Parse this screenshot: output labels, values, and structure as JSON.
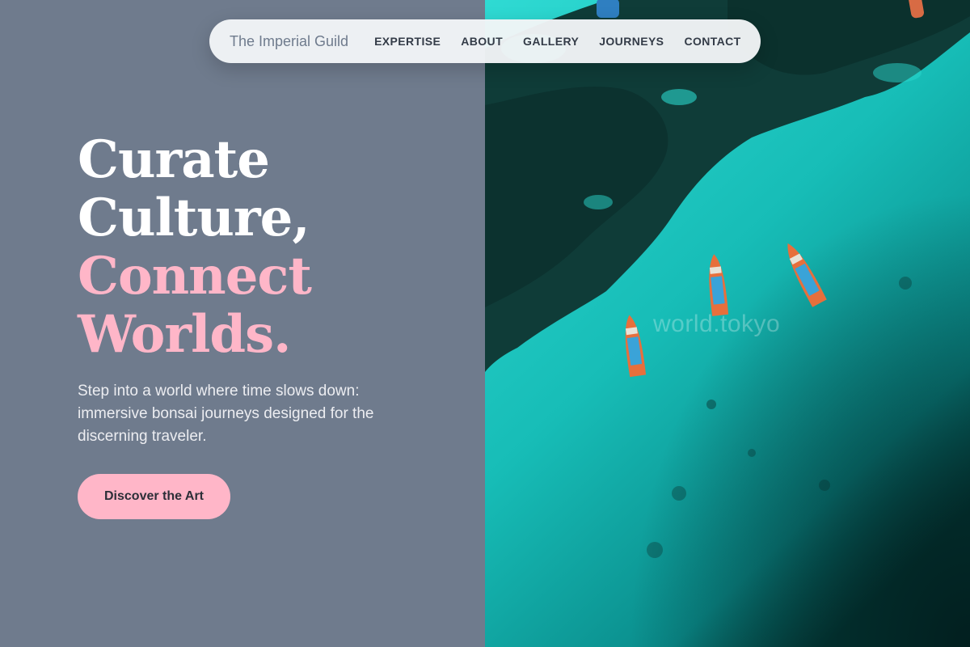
{
  "nav": {
    "brand": "The Imperial Guild",
    "links": [
      "EXPERTISE",
      "ABOUT",
      "GALLERY",
      "JOURNEYS",
      "CONTACT"
    ]
  },
  "hero": {
    "title_white": [
      "Curate",
      "Culture,"
    ],
    "title_pink": [
      "Connect",
      "Worlds."
    ],
    "subtitle": "Step into a world where time slows down: immersive bonsai journeys designed for the discerning traveler.",
    "cta_label": "Discover the Art"
  },
  "image": {
    "subject": "aerial-ocean-boats-photo",
    "watermark": "world.tokyo"
  },
  "colors": {
    "panel_bg": "#6f7b8d",
    "accent_pink": "#ffb6c8",
    "nav_bg": "#f3f5f7",
    "nav_text": "#343c48",
    "sea": "#1fc7c0"
  }
}
